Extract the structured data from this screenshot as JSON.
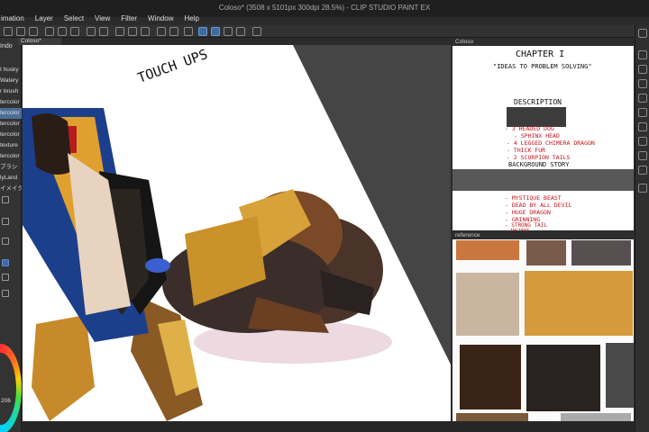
{
  "window": {
    "title": "Coloso* (3508 x 5101px 300dpi 28.5%) - CLIP STUDIO PAINT EX"
  },
  "menu": [
    "imation",
    "Layer",
    "Select",
    "View",
    "Filter",
    "Window",
    "Help"
  ],
  "left_panel": {
    "tab": "Indo",
    "brushes": [
      "t husky",
      "Watery",
      "r brush",
      "tercolor",
      "tercolor",
      "tercolor",
      "tercolor",
      "texture",
      "tercolor",
      "ブラシ",
      "lyLand",
      "イメイク"
    ],
    "selected_index": 4,
    "size_readout": "206"
  },
  "canvas": {
    "tab": "Coloso*",
    "annotation": "TOUCH UPS"
  },
  "doc_panel": {
    "tab": "Coloso",
    "heading": "CHAPTER I",
    "subtitle": "\"IDEAS TO PROBLEM SOLVING\"",
    "description_label": "DESCRIPTION",
    "list_items": [
      "- 3 HEADED DOG",
      "- SPHINX HEAD",
      "- 4 LEGGED CHIMERA DRAGON",
      "- THICK FUR",
      "- 2 SCORPION TAILS"
    ],
    "background_label": "BACKGROUND STORY",
    "story_items": [
      "- MYSTIQUE BEAST",
      "- DEAD BY ALL DEVIL",
      "- HUGE DRAGON",
      "- GRINNING",
      "- STRONG TAIL",
      "- ANCIENT"
    ]
  },
  "ref_panel": {
    "tab": "reference"
  },
  "colors": {
    "ui_dark": "#2b2b2b",
    "canvas_bg": "#454545",
    "selection": "#4c6f99",
    "note_red": "#c4161c"
  }
}
